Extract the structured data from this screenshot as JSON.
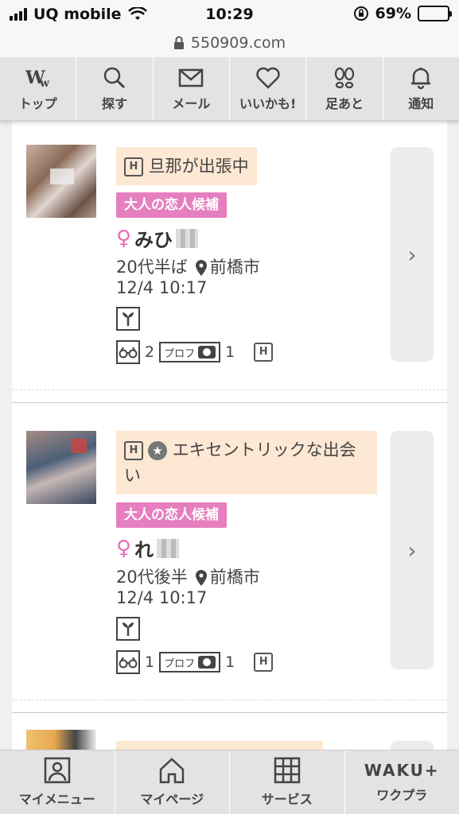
{
  "status_bar": {
    "carrier": "UQ mobile",
    "time": "10:29",
    "battery": "69%",
    "battery_level": 0.69
  },
  "url": "550909.com",
  "top_nav": [
    {
      "label": "トップ",
      "icon": "ww-logo-icon"
    },
    {
      "label": "探す",
      "icon": "search-icon"
    },
    {
      "label": "メール",
      "icon": "mail-icon"
    },
    {
      "label": "いいかも!",
      "icon": "heart-icon"
    },
    {
      "label": "足あと",
      "icon": "footprint-icon"
    },
    {
      "label": "通知",
      "icon": "bell-icon"
    }
  ],
  "cards": [
    {
      "headline": "旦那が出張中",
      "h_icon": "H",
      "badge": "大人の恋人候補",
      "gender": "♀",
      "name": "みひ",
      "age": "20代半ば",
      "location": "前橋市",
      "datetime": "12/4 10:17",
      "glasses_count": "2",
      "prof_label": "プロフ",
      "photo_count": "1"
    },
    {
      "headline": "エキセントリックな出会い",
      "h_icon": "H",
      "badge": "大人の恋人候補",
      "gender": "♀",
      "name": "れ",
      "age": "20代後半",
      "location": "前橋市",
      "datetime": "12/4 10:17",
      "glasses_count": "1",
      "prof_label": "プロフ",
      "photo_count": "1"
    }
  ],
  "bottom_nav": [
    {
      "label": "マイメニュー",
      "icon": "person-icon"
    },
    {
      "label": "マイページ",
      "icon": "home-icon"
    },
    {
      "label": "サービス",
      "icon": "grid-icon"
    },
    {
      "label": "ワクプラ",
      "logo": "WAKU+",
      "icon": "waku-plus-icon"
    }
  ],
  "colors": {
    "accent_pink": "#e57fbf",
    "headline_bg": "#fde8d3",
    "nav_bg": "#e5e2e5"
  }
}
